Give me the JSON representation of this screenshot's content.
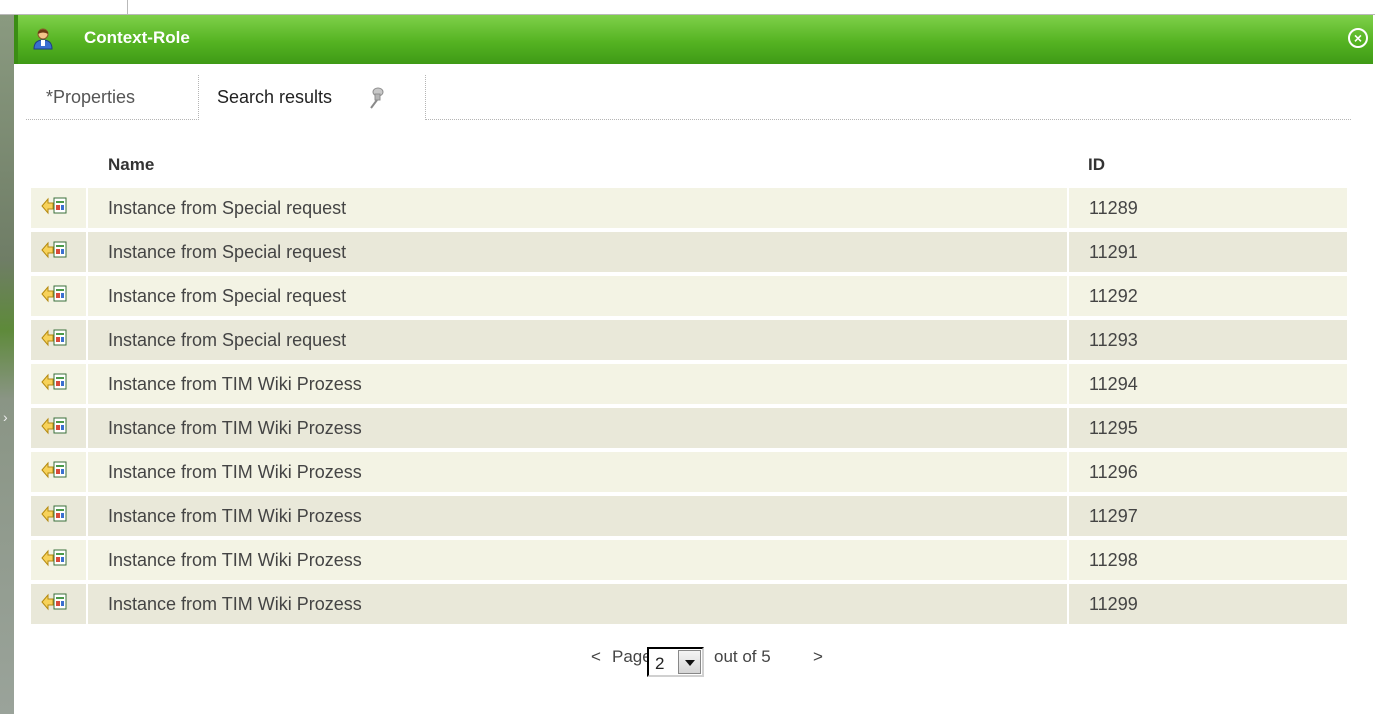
{
  "window": {
    "title": "Context-Role",
    "icon": "user-icon",
    "close_icon": "close-circle-icon",
    "accent_color": "#55b322"
  },
  "tabs": [
    {
      "label": "*Properties",
      "active": false
    },
    {
      "label": "Search results",
      "active": true,
      "icon": "pin-icon"
    }
  ],
  "table": {
    "columns": [
      "Name",
      "ID"
    ],
    "row_icon": "instance-icon",
    "rows": [
      {
        "name": "Instance from Special request",
        "id": "11289"
      },
      {
        "name": "Instance from Special request",
        "id": "11291"
      },
      {
        "name": "Instance from Special request",
        "id": "11292"
      },
      {
        "name": "Instance from Special request",
        "id": "11293"
      },
      {
        "name": "Instance from TIM Wiki Prozess",
        "id": "11294"
      },
      {
        "name": "Instance from TIM Wiki Prozess",
        "id": "11295"
      },
      {
        "name": "Instance from TIM Wiki Prozess",
        "id": "11296"
      },
      {
        "name": "Instance from TIM Wiki Prozess",
        "id": "11297"
      },
      {
        "name": "Instance from TIM Wiki Prozess",
        "id": "11298"
      },
      {
        "name": "Instance from TIM Wiki Prozess",
        "id": "11299"
      }
    ]
  },
  "pager": {
    "prev": "<",
    "page_label": "Page",
    "current_page": "2",
    "out_of": "out of 5",
    "next": ">"
  }
}
